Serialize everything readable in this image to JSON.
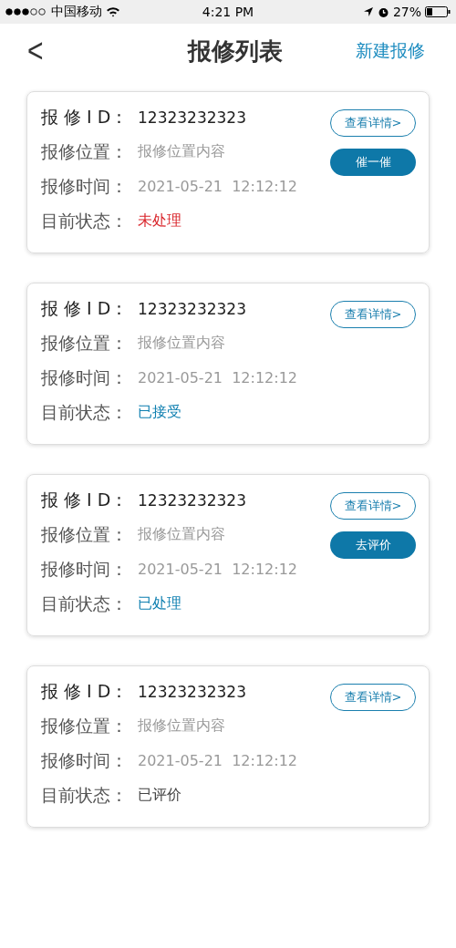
{
  "status_bar": {
    "carrier": "中国移动",
    "time": "4:21 PM",
    "battery": "27%"
  },
  "nav": {
    "back": "<",
    "title": "报修列表",
    "action": "新建报修"
  },
  "cards": [
    {
      "fields": [
        {
          "label": "报 修 I D：",
          "value": "12323232323"
        },
        {
          "label": "报修位置：",
          "value": "报修位置内容"
        },
        {
          "label": "报修时间：",
          "value": "2021-05-21  12:12:12"
        }
      ],
      "status_label": "目前状态：",
      "status": "未处理",
      "color": "#d9252b",
      "details": "查看详情>",
      "action": "催一催"
    },
    {
      "fields": [
        {
          "label": "报 修 I D：",
          "value": "12323232323"
        },
        {
          "label": "报修位置：",
          "value": "报修位置内容"
        },
        {
          "label": "报修时间：",
          "value": "2021-05-21  12:12:12"
        }
      ],
      "status_label": "目前状态：",
      "status": "已接受",
      "color": "#0e7fb0",
      "details": "查看详情>"
    },
    {
      "fields": [
        {
          "label": "报 修 I D：",
          "value": "12323232323"
        },
        {
          "label": "报修位置：",
          "value": "报修位置内容"
        },
        {
          "label": "报修时间：",
          "value": "2021-05-21  12:12:12"
        }
      ],
      "status_label": "目前状态：",
      "status": "已处理",
      "color": "#0e7fb0",
      "details": "查看详情>",
      "action": "去评价"
    },
    {
      "fields": [
        {
          "label": "报 修 I D：",
          "value": "12323232323"
        },
        {
          "label": "报修位置：",
          "value": "报修位置内容"
        },
        {
          "label": "报修时间：",
          "value": "2021-05-21  12:12:12"
        }
      ],
      "status_label": "目前状态：",
      "status": "已评价",
      "color": "#444444",
      "details": "查看详情>"
    }
  ]
}
